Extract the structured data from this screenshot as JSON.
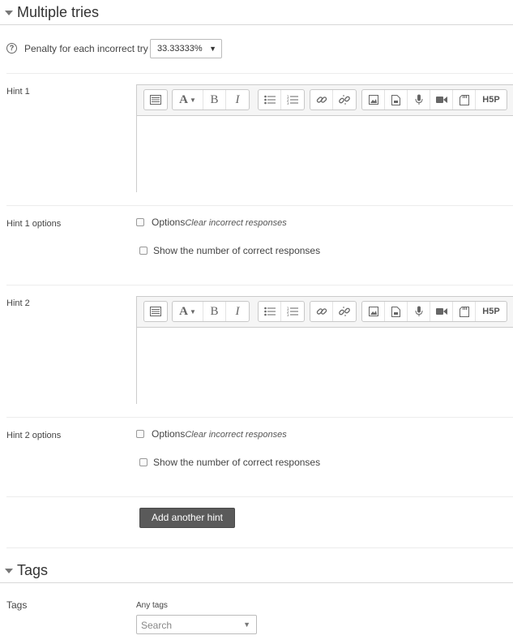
{
  "multiple_tries": {
    "title": "Multiple tries",
    "penalty_label": "Penalty for each incorrect try",
    "penalty_value": "33.33333%",
    "add_hint_label": "Add another hint"
  },
  "hints": [
    {
      "label": "Hint 1",
      "options_label": "Hint 1 options",
      "options_checkbox_label": "Options",
      "options_checkbox_sub": "Clear incorrect responses",
      "show_correct_label": "Show the number of correct responses"
    },
    {
      "label": "Hint 2",
      "options_label": "Hint 2 options",
      "options_checkbox_label": "Options",
      "options_checkbox_sub": "Clear incorrect responses",
      "show_correct_label": "Show the number of correct responses"
    }
  ],
  "editor_toolbar": {
    "font_button": "A",
    "bold_button": "B",
    "italic_button": "I",
    "h5p_button": "H5P",
    "icons": [
      "toggle-toolbar-icon",
      "font-style-icon",
      "bold-icon",
      "italic-icon",
      "unordered-list-icon",
      "ordered-list-icon",
      "link-icon",
      "unlink-icon",
      "image-icon",
      "media-icon",
      "record-audio-icon",
      "record-video-icon",
      "manage-files-icon",
      "h5p-icon"
    ]
  },
  "tags": {
    "title": "Tags",
    "label": "Tags",
    "any_tags_label": "Any tags",
    "search_placeholder": "Search"
  }
}
